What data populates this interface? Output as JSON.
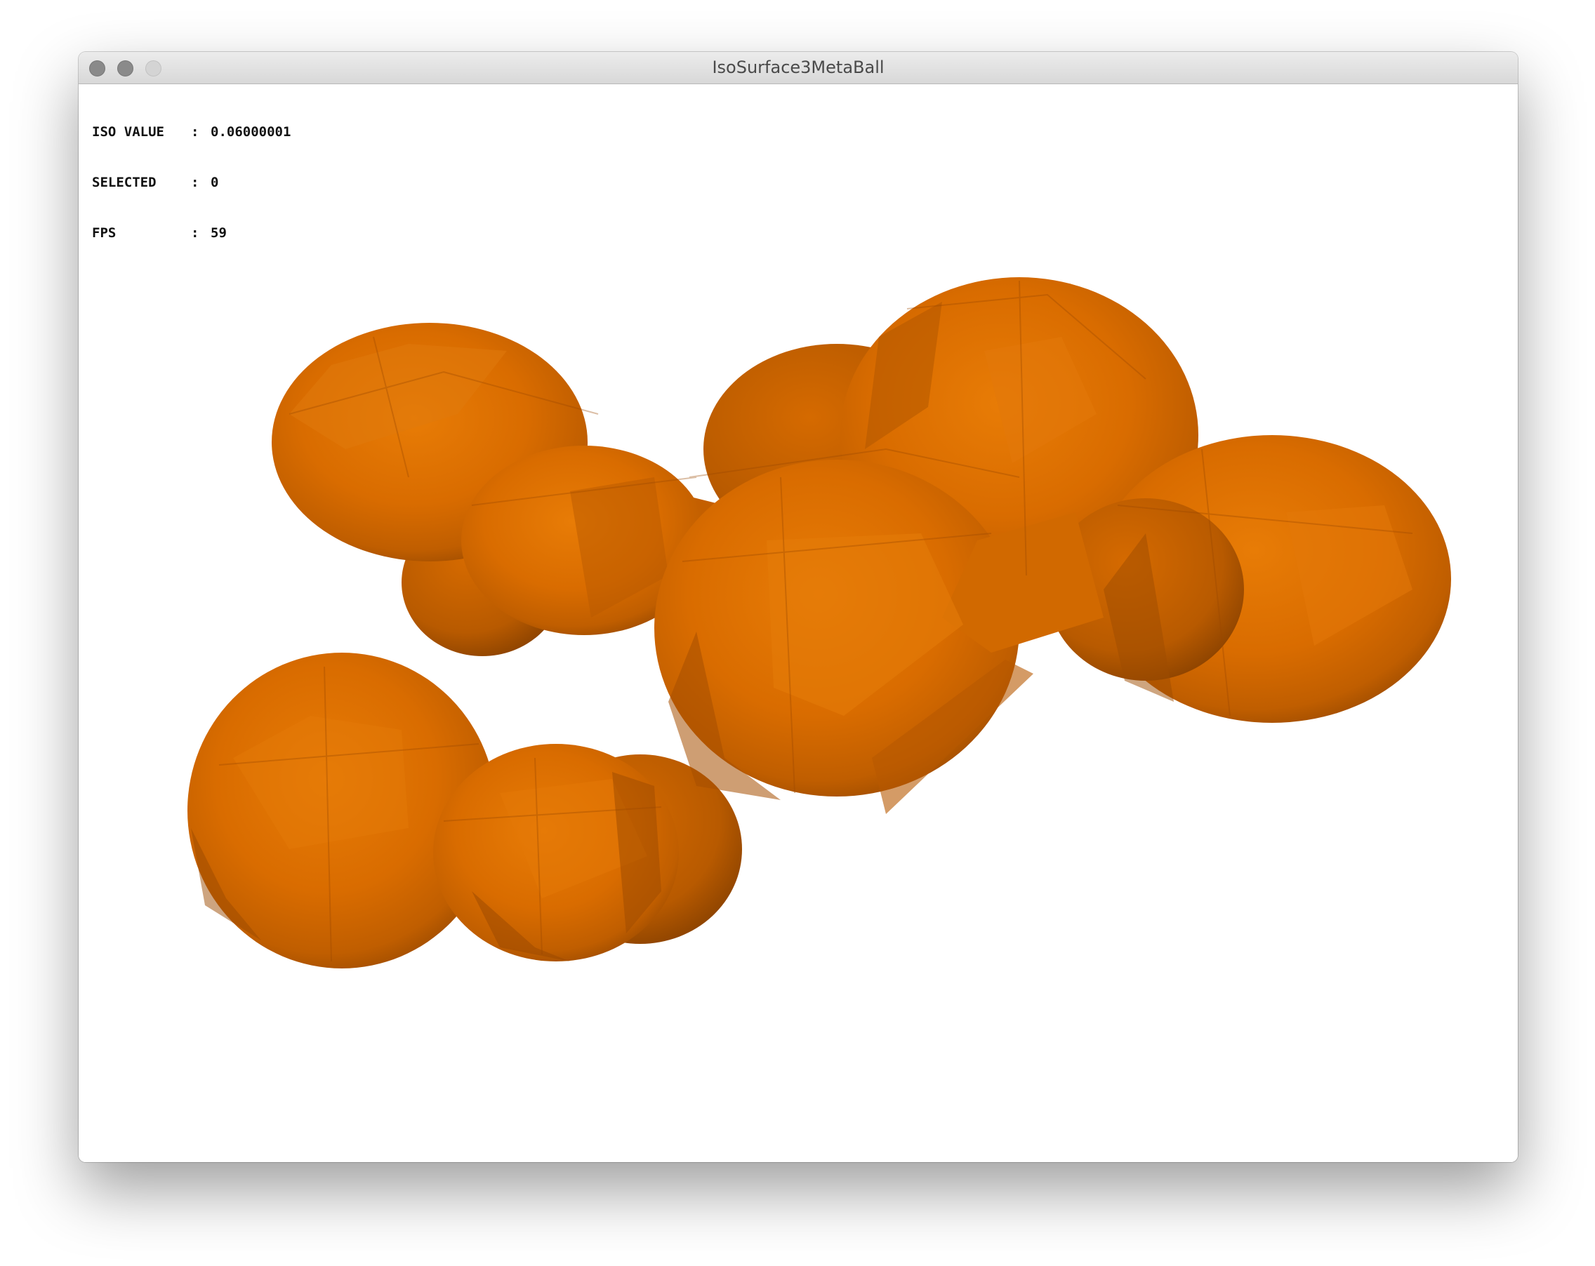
{
  "window": {
    "title": "IsoSurface3MetaBall"
  },
  "hud": {
    "rows": [
      {
        "label": "ISO VALUE",
        "sep": ":",
        "value": "0.06000001"
      },
      {
        "label": "SELECTED",
        "sep": ":",
        "value": "0"
      },
      {
        "label": "FPS",
        "sep": ":",
        "value": "59"
      }
    ]
  },
  "scene": {
    "object": "metaball isosurface",
    "base_color": "#dd6f00",
    "dark_color": "#a04a00",
    "highlight_color": "#e8810f",
    "background": "#ffffff"
  }
}
